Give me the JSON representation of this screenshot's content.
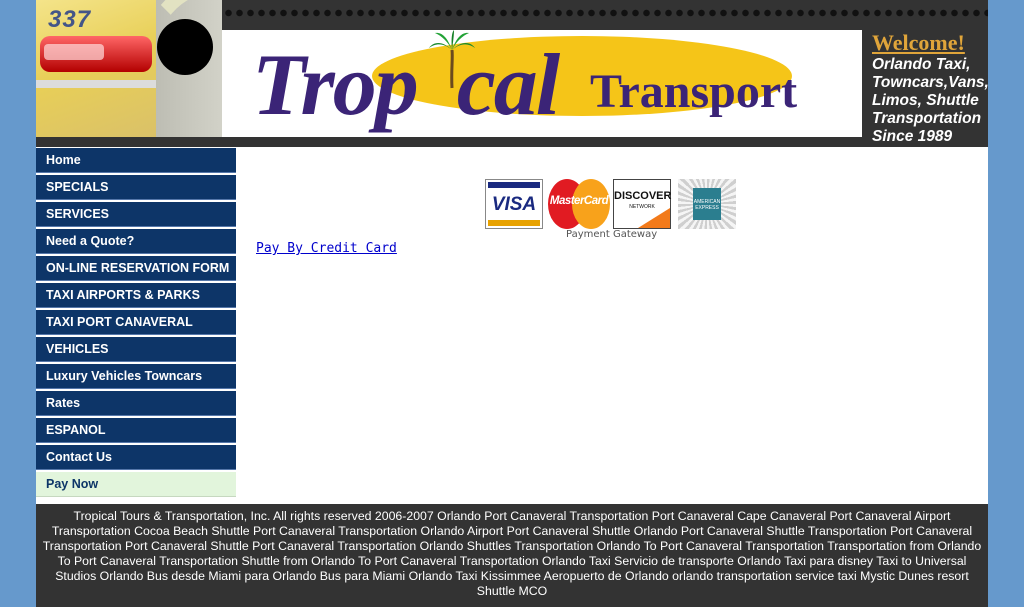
{
  "header": {
    "photo_number": "337",
    "logo_part1": "Trop",
    "logo_part2": "cal",
    "logo_part3": "Transport",
    "welcome": "Welcome!",
    "tagline": "Orlando Taxi, Towncars,Vans, Limos, Shuttle Transportation Since 1989"
  },
  "nav": {
    "items": [
      {
        "label": "Home"
      },
      {
        "label": "SPECIALS"
      },
      {
        "label": "SERVICES"
      },
      {
        "label": "Need a Quote?"
      },
      {
        "label": "ON-LINE RESERVATION FORM"
      },
      {
        "label": "TAXI AIRPORTS & PARKS"
      },
      {
        "label": "TAXI PORT CANAVERAL"
      },
      {
        "label": "VEHICLES"
      },
      {
        "label": "Luxury Vehicles Towncars"
      },
      {
        "label": "Rates"
      },
      {
        "label": "ESPANOL"
      },
      {
        "label": "Contact Us"
      },
      {
        "label": "Pay Now"
      }
    ],
    "active_index": 12
  },
  "content": {
    "cards": {
      "visa": "VISA",
      "mastercard": "MasterCard",
      "discover": "DISCOVER",
      "discover_sub": "NETWORK",
      "amex": "AMERICAN EXPRESS"
    },
    "gateway_label": "Payment Gateway",
    "pay_link": "Pay By Credit Card"
  },
  "footer": {
    "text": "Tropical Tours & Transportation, Inc. All rights reserved 2006-2007 Orlando Port Canaveral Transportation Port Canaveral Cape Canaveral Port Canaveral Airport Transportation Cocoa Beach Shuttle Port Canaveral Transportation Orlando Airport Port Canaveral Shuttle Orlando Port Canaveral Shuttle Transportation Port Canaveral Transportation Port Canaveral Shuttle Port Canaveral Transportation Orlando Shuttles Transportation Orlando To Port Canaveral Transportation Transportation from Orlando To Port Canaveral Transportation Shuttle from Orlando To Port Canaveral Transportation Orlando Taxi Servicio de transporte Orlando Taxi para disney Taxi to Universal Studios Orlando Bus desde Miami para Orlando Bus para Miami Orlando Taxi Kissimmee Aeropuerto de Orlando orlando transportation service taxi Mystic Dunes resort Shuttle MCO"
  },
  "colors": {
    "page_bg": "#6699cc",
    "header_bg": "#333333",
    "nav_bg": "#0d3568",
    "nav_active_bg": "#e2f5dc",
    "logo_purple": "#3b2477",
    "sun_yellow": "#f5c518",
    "welcome_gold": "#e0a53a"
  }
}
